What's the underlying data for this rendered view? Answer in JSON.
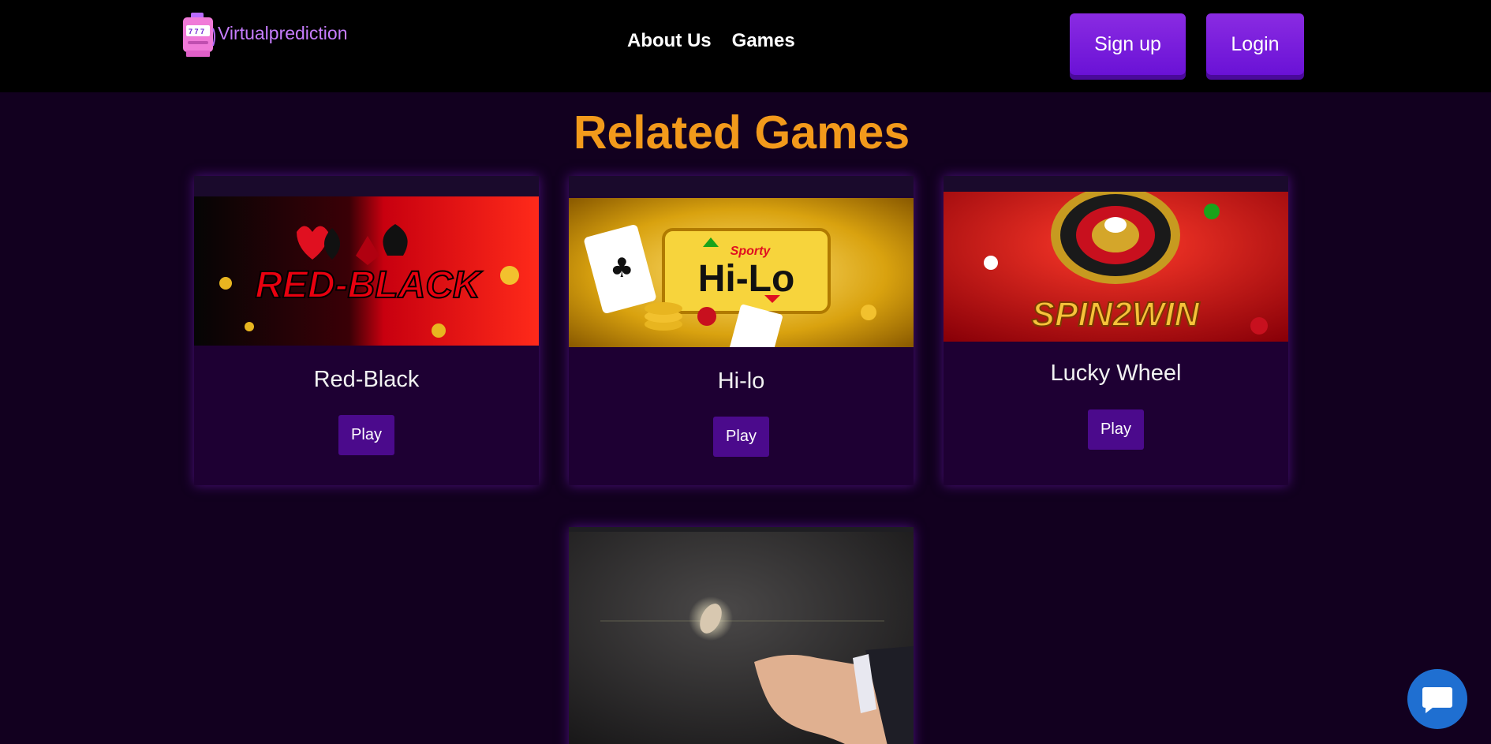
{
  "header": {
    "logo_text": "Virtualprediction",
    "nav": [
      {
        "label": "About Us"
      },
      {
        "label": "Games"
      }
    ],
    "signup_label": "Sign up",
    "login_label": "Login"
  },
  "section": {
    "title": "Related Games"
  },
  "games": [
    {
      "title": "Red-Black",
      "play_label": "Play",
      "banner_text": "RED-BLACK"
    },
    {
      "title": "Hi-lo",
      "play_label": "Play",
      "banner_brand": "Sporty",
      "banner_text": "Hi-Lo"
    },
    {
      "title": "Lucky Wheel",
      "play_label": "Play",
      "banner_text": "SPIN2WIN"
    },
    {
      "title": "",
      "play_label": ""
    }
  ],
  "colors": {
    "accent": "#8a2be2",
    "title": "#f29a1b",
    "background": "#12001f",
    "play_button": "#4b0a8c",
    "chat": "#1f6fd1"
  },
  "icons": {
    "logo": "slot-machine-icon",
    "chat": "chat-bubble-icon"
  }
}
